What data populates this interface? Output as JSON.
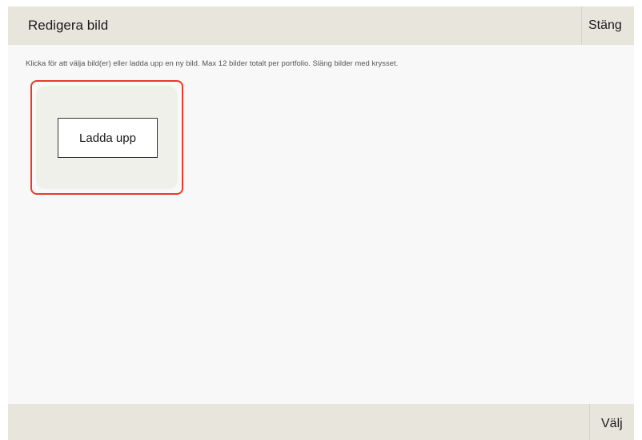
{
  "header": {
    "title": "Redigera bild",
    "close_label": "Stäng"
  },
  "main": {
    "instructions": "Klicka för att välja bild(er) eller ladda upp en ny bild. Max 12 bilder totalt per portfolio. Släng bilder med krysset.",
    "upload_label": "Ladda upp"
  },
  "footer": {
    "select_label": "Välj"
  },
  "colors": {
    "header_bg": "#e8e6dc",
    "content_bg": "#f8f8f8",
    "highlight_border": "#e83a2a",
    "tile_bg": "#f0f0ea"
  }
}
